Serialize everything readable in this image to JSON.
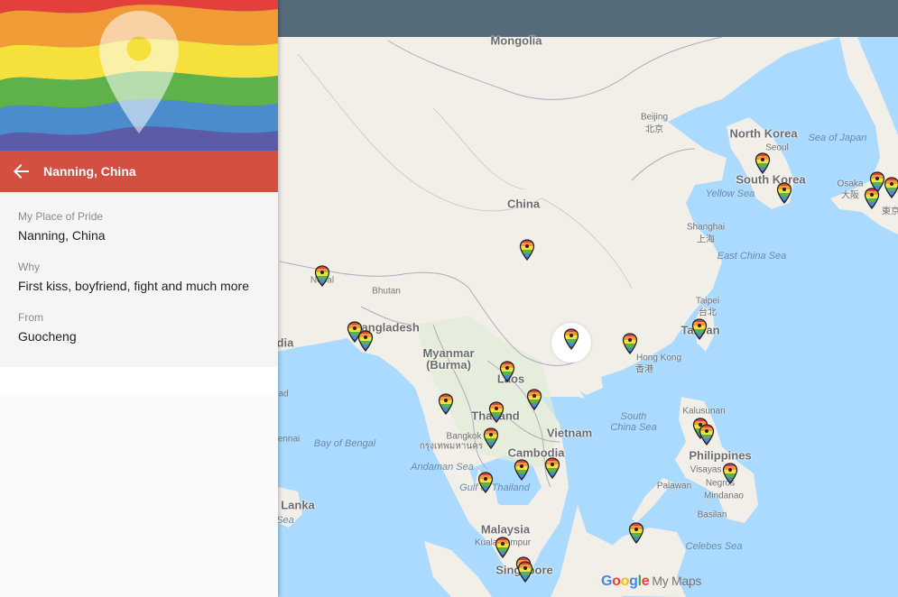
{
  "panel": {
    "header_title": "Nanning, China",
    "fields": [
      {
        "label": "My Place of Pride",
        "value": "Nanning, China"
      },
      {
        "label": "Why",
        "value": "First kiss, boyfriend, fight and much more"
      },
      {
        "label": "From",
        "value": "Guocheng"
      }
    ]
  },
  "map": {
    "attribution": {
      "google": "Google",
      "product": "My Maps"
    },
    "colors": {
      "water": "#aadaff",
      "land": "#f2efe9",
      "header": "#566b79",
      "panel_title": "#d34f41"
    },
    "labels": {
      "mongolia": "Mongolia",
      "china": "China",
      "north_korea": "North Korea",
      "south_korea": "South Korea",
      "sea_of_japan": "Sea of Japan",
      "yellow_sea": "Yellow Sea",
      "east_china_sea": "East China Sea",
      "beijing": "Beijing",
      "beijing_cn": "北京",
      "seoul": "Seoul",
      "osaka": "Osaka",
      "osaka_jp": "大阪",
      "tokyo_jp": "東京",
      "shanghai": "Shanghai",
      "shanghai_cn": "上海",
      "taipei": "Taipei",
      "taipei_cn": "台北",
      "taiwan": "Taiwan",
      "hong_kong": "Hong Kong",
      "hong_kong_cn": "香港",
      "nepal": "Nepal",
      "bhutan": "Bhutan",
      "bangladesh": "Bangladesh",
      "india_partial": "dia",
      "india_city_partial": "ad",
      "chennai_partial": "ennai",
      "sri_lanka": "Lanka",
      "sea_partial": "Sea",
      "myanmar": "Myanmar\n(Burma)",
      "laos": "Laos",
      "thailand": "Thailand",
      "bangkok": "Bangkok",
      "bangkok_th": "กรุงเทพมหานคร",
      "cambodia": "Cambodia",
      "vietnam": "Vietnam",
      "bay_of_bengal": "Bay of Bengal",
      "andaman_sea": "Andaman Sea",
      "gulf_of_thailand": "Gulf of Thailand",
      "south_china_sea": "South\nChina Sea",
      "philippines": "Philippines",
      "kalusunan": "Kalusunan",
      "visayas": "Visayas",
      "negros": "Negros",
      "mindanao": "Mindanao",
      "palawan": "Palawan",
      "basilan": "Basilan",
      "celebes_sea": "Celebes Sea",
      "malaysia": "Malaysia",
      "kuala_lumpur": "Kuala Lumpur",
      "singapore": "Singapore"
    }
  }
}
